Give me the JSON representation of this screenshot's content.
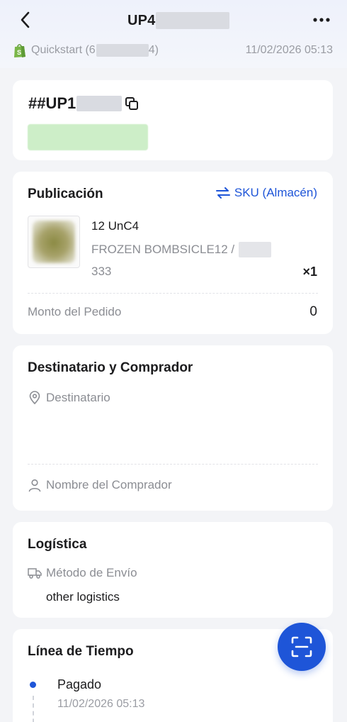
{
  "header": {
    "title_prefix": "UP4",
    "store_name_prefix": "Quickstart (6",
    "store_name_suffix": "4)",
    "timestamp": "11/02/2026 05:13",
    "store_icon": "shopify-bag-icon",
    "back_icon": "chevron-left-icon",
    "more_icon": "more-horizontal-icon"
  },
  "order": {
    "id_prefix": "##UP1",
    "copy_icon": "copy-icon",
    "status_color": "#cdeec8"
  },
  "publication": {
    "title": "Publicación",
    "sku_link": "SKU (Almacén)",
    "sku_icon": "swap-arrows-icon",
    "product": {
      "name": "12 UnC4",
      "variant": "FROZEN BOMBSICLE12 /",
      "sku": "333",
      "quantity": "×1"
    },
    "amount_label": "Monto del Pedido",
    "amount_value": "0"
  },
  "recipient": {
    "title": "Destinatario y Comprador",
    "recipient_label": "Destinatario",
    "recipient_icon": "location-pin-icon",
    "buyer_label": "Nombre del Comprador",
    "buyer_icon": "person-icon"
  },
  "logistics": {
    "title": "Logística",
    "method_label": "Método de Envío",
    "method_icon": "truck-icon",
    "method_value": "other logistics"
  },
  "timeline": {
    "title": "Línea de Tiempo",
    "events": [
      {
        "label": "Pagado",
        "time": "11/02/2026 05:13"
      }
    ]
  },
  "fab": {
    "icon": "scan-icon"
  },
  "colors": {
    "accent": "#1e55d8",
    "page_bg": "#f3f4f7"
  }
}
